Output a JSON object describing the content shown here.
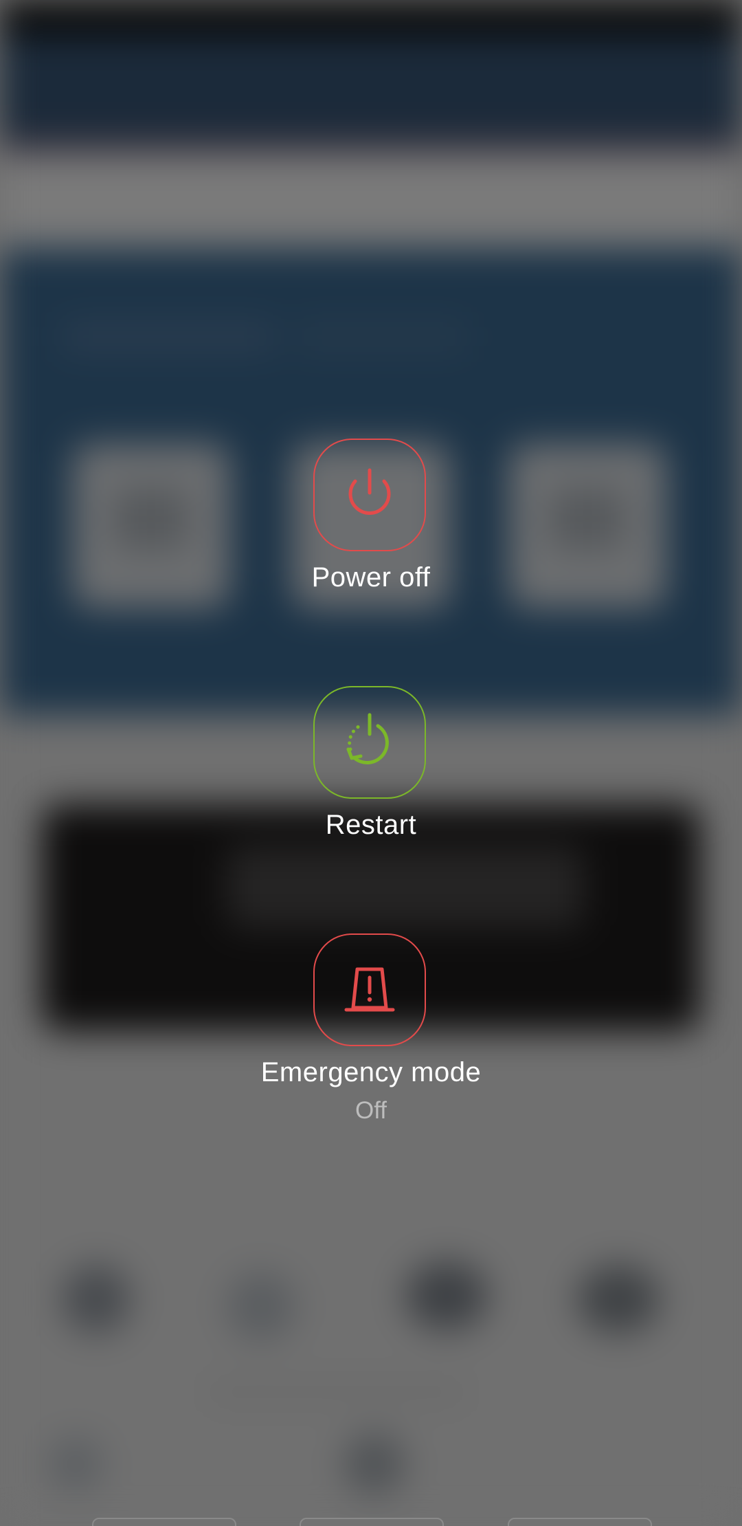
{
  "power_menu": {
    "options": [
      {
        "id": "power-off",
        "label": "Power off",
        "icon": "power-icon",
        "color": "#e34b4b"
      },
      {
        "id": "restart",
        "label": "Restart",
        "icon": "restart-icon",
        "color": "#7cb829"
      },
      {
        "id": "emergency-mode",
        "label": "Emergency mode",
        "status": "Off",
        "icon": "emergency-beacon-icon",
        "color": "#e34b4b"
      }
    ]
  }
}
